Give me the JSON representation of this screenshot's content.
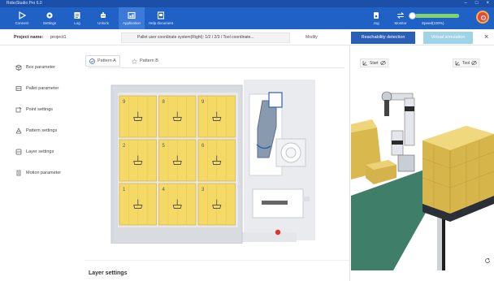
{
  "app": {
    "title": "RoboStudio Pro 6.0",
    "window_controls": [
      "–",
      "□",
      "×"
    ]
  },
  "toolbar": {
    "items": [
      {
        "label": "Connect",
        "icon": "play-icon"
      },
      {
        "label": "Settings",
        "icon": "gear-icon"
      },
      {
        "label": "Log",
        "icon": "log-icon"
      },
      {
        "label": "Unlock",
        "icon": "robot-icon"
      },
      {
        "label": "Application",
        "icon": "application-icon"
      },
      {
        "label": "Help document",
        "icon": "document-icon"
      }
    ],
    "right_items": [
      {
        "label": "Jog",
        "icon": "jog-icon"
      },
      {
        "label": "Monitor",
        "icon": "monitor-icon"
      }
    ],
    "speed": {
      "label": "Speed(100%)",
      "value": 1.0
    }
  },
  "project": {
    "label": "Project name:",
    "value": "project1",
    "coordinate_info": "Pallet user coordinate system(Right): 1/2 / 2/3 / Tool coordinate...",
    "modify_label": "Modify",
    "reachability_button": "Reachability detection",
    "visual_button": "Virtual simulation"
  },
  "sidebar": {
    "items": [
      {
        "label": "Box parameter",
        "icon": "box-icon"
      },
      {
        "label": "Pallet parameter",
        "icon": "pallet-icon"
      },
      {
        "label": "Point settings",
        "icon": "point-icon"
      },
      {
        "label": "Pattern settings",
        "icon": "pattern-icon",
        "active": true
      },
      {
        "label": "Layer settings",
        "icon": "layer-icon"
      },
      {
        "label": "Motion parameter",
        "icon": "motion-icon"
      }
    ]
  },
  "tabs": [
    {
      "label": "Pattern A",
      "active": true
    },
    {
      "label": "Pattern B",
      "active": false
    }
  ],
  "pallet": {
    "box_numbers": [
      "9",
      "8",
      "9",
      "2",
      "5",
      "6",
      "1",
      "4",
      "3"
    ]
  },
  "section_title": "Layer settings",
  "view3d": {
    "left_tool": "Start",
    "right_tool": "Tool"
  },
  "colors": {
    "toolbar_blue": "#2061c6",
    "box_yellow": "#f4d966",
    "reach_button": "#2a5fb8",
    "visual_button": "#9fd3e8",
    "estop_red": "#e4493c"
  }
}
